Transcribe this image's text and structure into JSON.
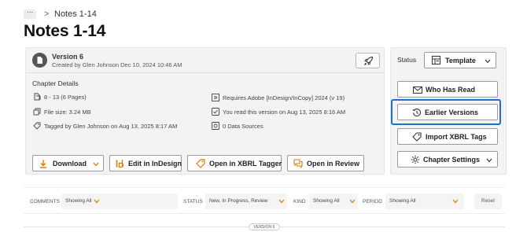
{
  "breadcrumb": {
    "more": "···",
    "separator": ">",
    "current": "Notes 1-14"
  },
  "page_title": "Notes 1-14",
  "version": {
    "title": "Version 6",
    "created": "Created by Glen Johnson Dec 10, 2024 10:46 AM"
  },
  "chapter_details": {
    "title": "Chapter Details",
    "pages": "8 - 13 (6 Pages)",
    "file_size": "File size: 3.24 MB",
    "tagged": "Tagged by Glen Johnson on Aug 13, 2025 8:17 AM",
    "requires": "Requires Adobe [InDesign/InCopy] 2024 (v 19)",
    "read": "You read this version on Aug 13, 2025 8:16 AM",
    "data_sources": "0 Data Sources"
  },
  "actions": {
    "download": "Download",
    "edit_indesign": "Edit in InDesign",
    "open_xbrl": "Open in XBRL Tagger",
    "open_review": "Open in Review"
  },
  "right_panel": {
    "status_label": "Status",
    "status_value": "Template",
    "who_has_read": "Who Has Read",
    "earlier_versions": "Earlier Versions",
    "import_xbrl": "Import XBRL Tags",
    "chapter_settings": "Chapter Settings"
  },
  "filters": {
    "comments_label": "COMMENTS",
    "comments_value": "Showing All",
    "status_label": "STATUS",
    "status_value": "New, In Progress, Review",
    "kind_label": "KIND",
    "kind_value": "Showing All",
    "period_label": "PERIOD",
    "period_value": "Showing All",
    "reset": "Reset"
  },
  "version_marker": "VERSION 6",
  "colors": {
    "accent": "#e07b00",
    "highlight": "#1d6fd1",
    "panel": "#f3f3f3"
  }
}
